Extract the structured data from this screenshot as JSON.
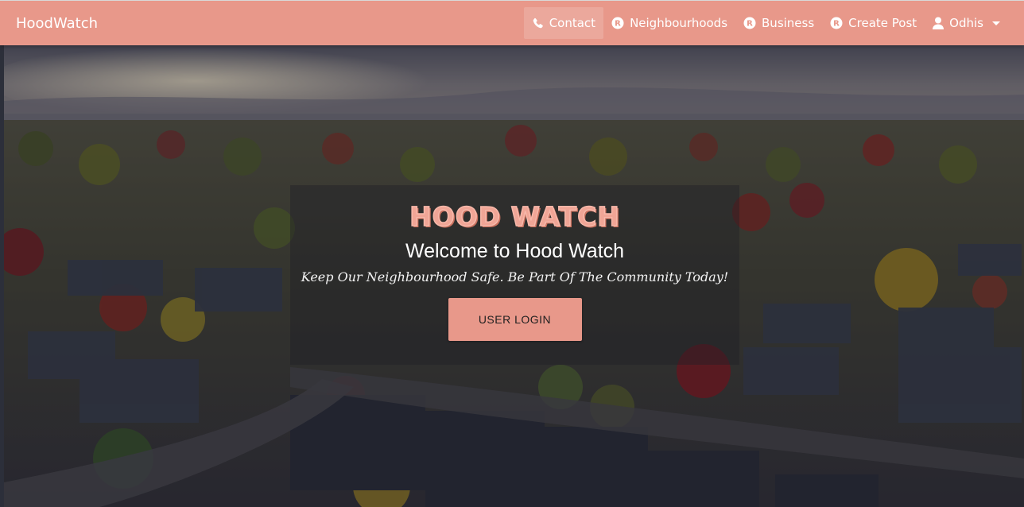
{
  "nav": {
    "brand": "HoodWatch",
    "items": [
      {
        "label": "Contact",
        "icon": "phone-icon",
        "active": true
      },
      {
        "label": "Neighbourhoods",
        "icon": "registered-icon"
      },
      {
        "label": "Business",
        "icon": "registered-icon"
      },
      {
        "label": "Create Post",
        "icon": "registered-icon"
      },
      {
        "label": "Odhis",
        "icon": "user-icon",
        "dropdown": true
      }
    ]
  },
  "hero": {
    "logo_title": "HOOD WATCH",
    "welcome": "Welcome to Hood Watch",
    "tagline": "Keep Our Neighbourhood Safe. Be Part Of The Community Today!",
    "login_button": "USER LOGIN"
  },
  "colors": {
    "accent": "#e8988a",
    "nav_text": "#ffffff"
  }
}
